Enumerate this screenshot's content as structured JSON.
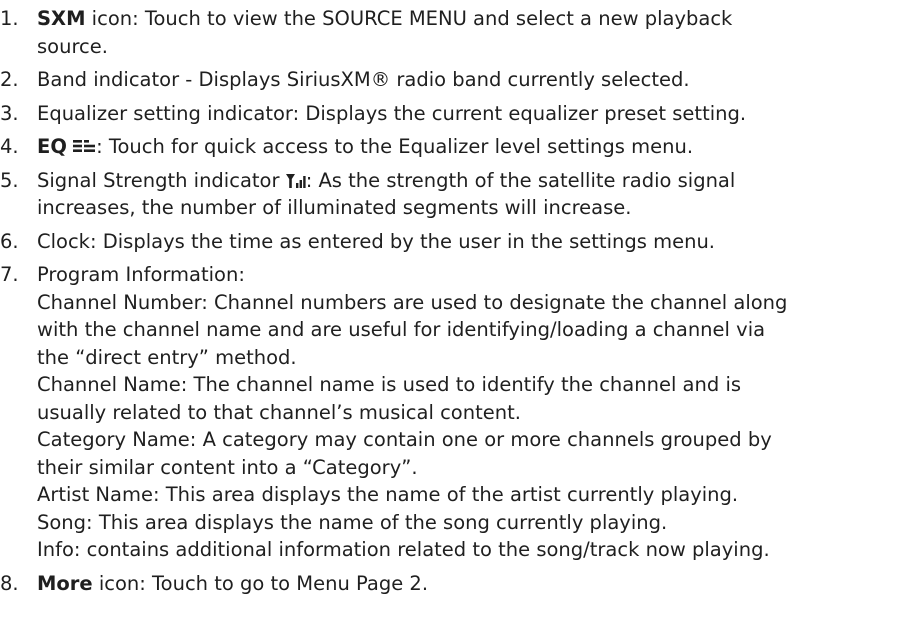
{
  "items": [
    {
      "num": "1.",
      "bold": "SXM",
      "line1": " icon: Touch to view the SOURCE MENU and select a new playback",
      "line2": "source."
    },
    {
      "num": "2.",
      "text": "Band indicator - Displays SiriusXM® radio band currently selected."
    },
    {
      "num": "3.",
      "text": "Equalizer setting indicator: Displays the current equalizer preset setting."
    },
    {
      "num": "4.",
      "bold": "EQ",
      "icon": "equalizer-bars-icon",
      "text": ": Touch for quick access to the Equalizer level settings menu."
    },
    {
      "num": "5.",
      "lead": "Signal Strength indicator",
      "icon": "signal-strength-icon",
      "line1": ": As the strength of the satellite radio signal",
      "line2": "increases, the number of illuminated segments will increase."
    },
    {
      "num": "6.",
      "text": "Clock: Displays the time as entered by the user in the settings menu."
    },
    {
      "num": "7.",
      "lines": [
        "Program Information:",
        "Channel Number: Channel numbers are used to designate the channel along",
        "with the channel name and are useful for identifying/loading a channel via",
        "the “direct entry” method.",
        "Channel Name: The channel name is used to identify the channel and is",
        "usually related to that channel’s musical content.",
        "Category Name: A category may contain one or more channels grouped by",
        "their similar content into a “Category”.",
        "Artist Name: This area displays the name of the artist currently playing.",
        "Song: This area displays the name of the song currently playing.",
        "Info: contains additional information related to the song/track now playing."
      ]
    },
    {
      "num": "8.",
      "bold": "More",
      "text": " icon: Touch to go to Menu Page 2."
    }
  ]
}
